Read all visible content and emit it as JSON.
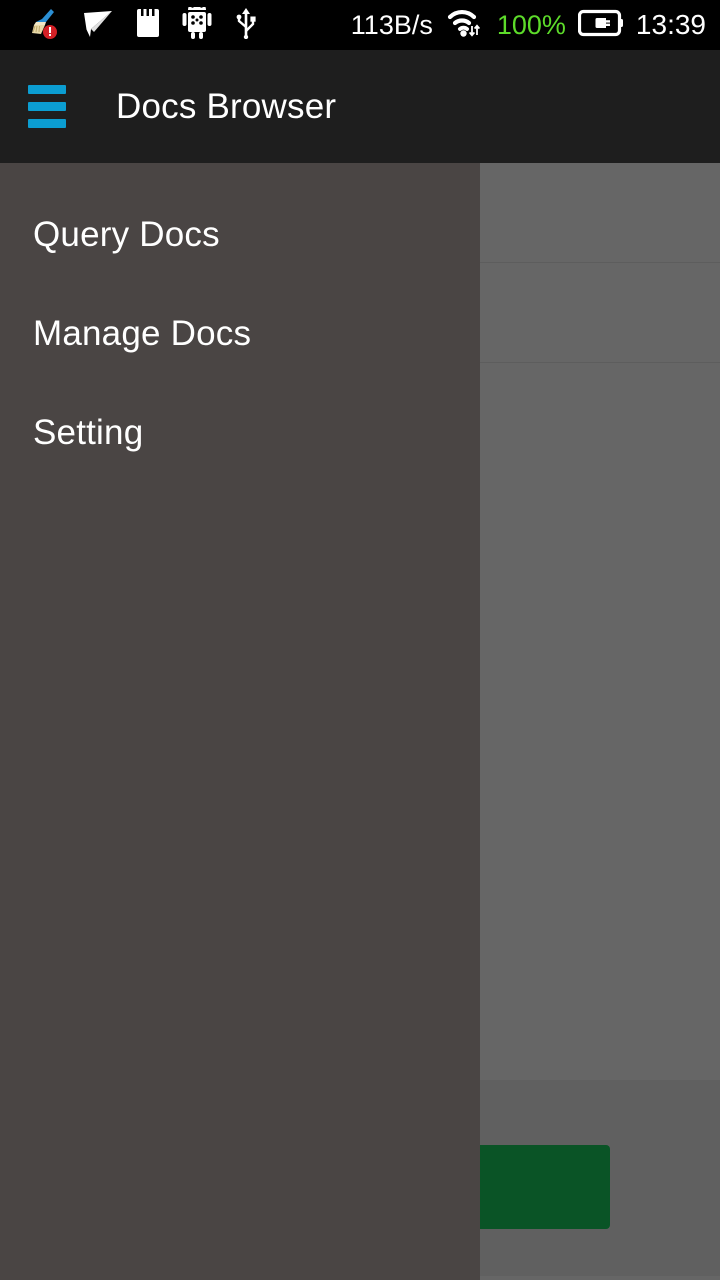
{
  "status_bar": {
    "network_speed": "113B/s",
    "battery_percent": "100%",
    "clock": "13:39",
    "left_icons": [
      {
        "name": "cleaner-icon",
        "label": "cleaner-alert"
      },
      {
        "name": "paper-plane-icon",
        "label": "telegram"
      },
      {
        "name": "sim-card-icon",
        "label": "sim-card"
      },
      {
        "name": "android-robot-icon",
        "label": "android"
      },
      {
        "name": "usb-icon",
        "label": "usb"
      }
    ],
    "right_icons": [
      {
        "name": "wifi-icon",
        "label": "wifi-data"
      },
      {
        "name": "battery-charging-icon",
        "label": "battery-charging"
      }
    ],
    "colors": {
      "background": "#000000",
      "text": "#ffffff",
      "battery_text": "#5ddb2a"
    }
  },
  "app_bar": {
    "title": "Docs Browser",
    "menu_icon": "hamburger-menu-icon",
    "colors": {
      "background": "#1e1e1e",
      "title": "#ffffff",
      "menu_icon": "#0b9dd1"
    }
  },
  "drawer": {
    "open": true,
    "items": [
      {
        "label": "Query Docs",
        "name": "query-docs"
      },
      {
        "label": "Manage Docs",
        "name": "manage-docs"
      },
      {
        "label": "Setting",
        "name": "setting"
      }
    ],
    "colors": {
      "background": "#4a4544",
      "label": "#ffffff"
    }
  },
  "content": {
    "scrim_color": "#666666",
    "divider_color": "#5d5d5d",
    "rows": [
      {
        "name": "list-row-1"
      },
      {
        "name": "list-row-2"
      }
    ],
    "primary_button": {
      "name": "primary-action-button",
      "label": "",
      "color": "#0a5426"
    }
  }
}
